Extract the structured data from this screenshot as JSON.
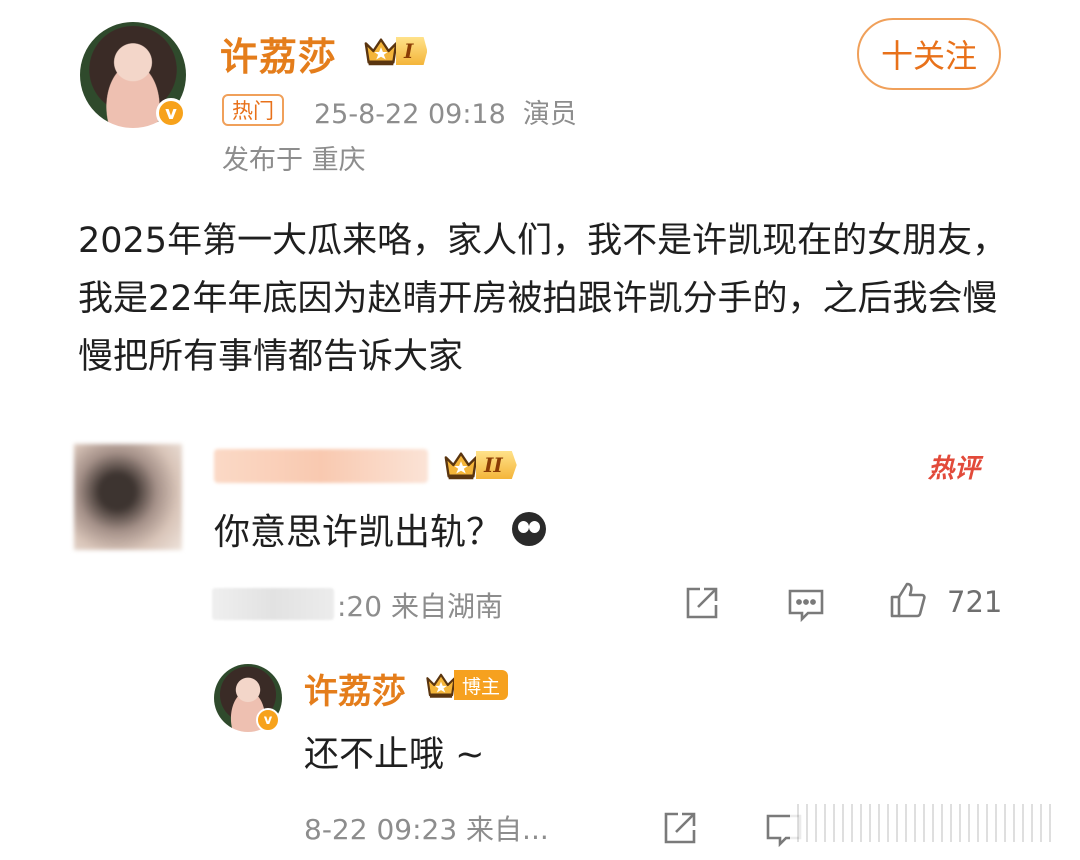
{
  "post": {
    "author": "许荔莎",
    "level": "I",
    "follow_label": "十关注",
    "hot_tag": "热门",
    "time_and_role": "25-8-22 09:18  演员",
    "location": "发布于 重庆",
    "body": "2025年第一大瓜来咯，家人们，我不是许凯现在的女朋友，我是22年年底因为赵晴开房被拍跟许凯分手的，之后我会慢慢把所有事情都告诉大家"
  },
  "comment": {
    "level": "II",
    "hot_label": "热评",
    "text": "你意思许凯出轨？",
    "meta": ":20 来自湖南",
    "like_count": "721"
  },
  "reply": {
    "author": "许荔莎",
    "role_tag": "博主",
    "text": "还不止哦 ~",
    "meta": "8-22 09:23 来自..."
  },
  "icons": {
    "verified": "verified-v-icon",
    "crown": "crown-icon",
    "share": "share-icon",
    "comment": "comment-icon",
    "like": "thumbs-up-icon",
    "emoji": "crying-face-icon"
  },
  "colors": {
    "brand_orange": "#e47d1b",
    "meta_gray": "#8d8d8d",
    "hot_red": "#e24a3a"
  }
}
